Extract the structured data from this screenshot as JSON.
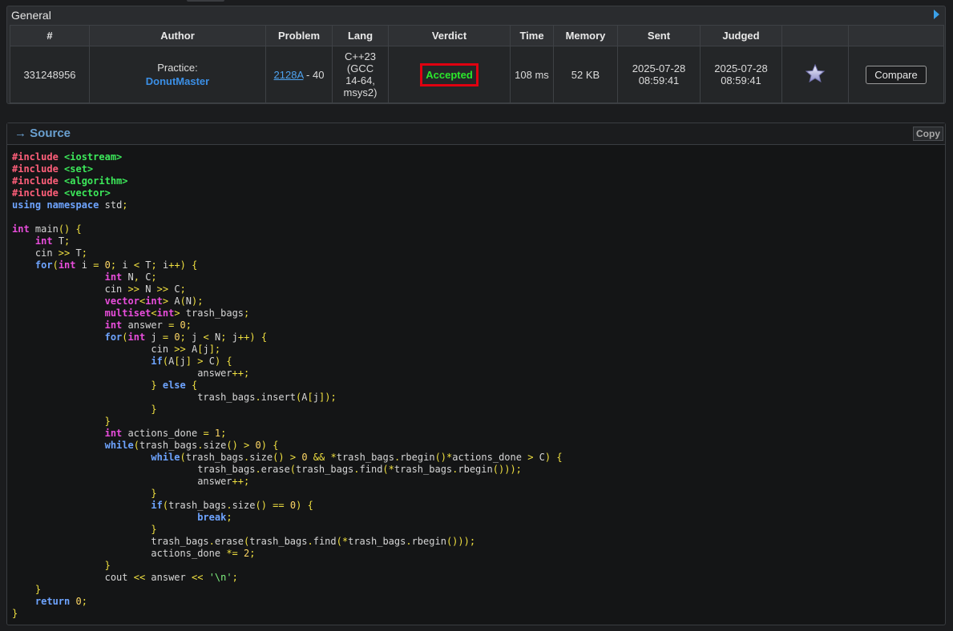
{
  "general": {
    "title": "General",
    "columns": [
      "#",
      "Author",
      "Problem",
      "Lang",
      "Verdict",
      "Time",
      "Memory",
      "Sent",
      "Judged",
      "",
      ""
    ],
    "submission": {
      "id": "331248956",
      "author_prefix": "Practice:",
      "author_name": "DonutMaster",
      "problem_link": "2128A",
      "problem_suffix": " - 40",
      "lang_lines": [
        "C++23",
        "(GCC",
        "14-64,",
        "msys2)"
      ],
      "verdict": "Accepted",
      "time": "108 ms",
      "memory": "52 KB",
      "sent_date": "2025-07-28",
      "sent_time": "08:59:41",
      "judged_date": "2025-07-28",
      "judged_time": "08:59:41",
      "favorite_icon": "star-icon",
      "compare_label": "Compare"
    }
  },
  "source": {
    "title": "Source",
    "arrow": "→",
    "copy_label": "Copy",
    "code_lines": [
      "#include <iostream>",
      "#include <set>",
      "#include <algorithm>",
      "#include <vector>",
      "using namespace std;",
      "",
      "int main() {",
      "    int T;",
      "    cin >> T;",
      "    for(int i = 0; i < T; i++) {",
      "                int N, C;",
      "                cin >> N >> C;",
      "                vector<int> A(N);",
      "                multiset<int> trash_bags;",
      "                int answer = 0;",
      "                for(int j = 0; j < N; j++) {",
      "                        cin >> A[j];",
      "                        if(A[j] > C) {",
      "                                answer++;",
      "                        } else {",
      "                                trash_bags.insert(A[j]);",
      "                        }",
      "                }",
      "                int actions_done = 1;",
      "                while(trash_bags.size() > 0) {",
      "                        while(trash_bags.size() > 0 && *trash_bags.rbegin()*actions_done > C) {",
      "                                trash_bags.erase(trash_bags.find(*trash_bags.rbegin()));",
      "                                answer++;",
      "                        }",
      "                        if(trash_bags.size() == 0) {",
      "                                break;",
      "                        }",
      "                        trash_bags.erase(trash_bags.find(*trash_bags.rbegin()));",
      "                        actions_done *= 2;",
      "                }",
      "                cout << answer << '\\n';",
      "    }",
      "    return 0;",
      "}"
    ]
  }
}
